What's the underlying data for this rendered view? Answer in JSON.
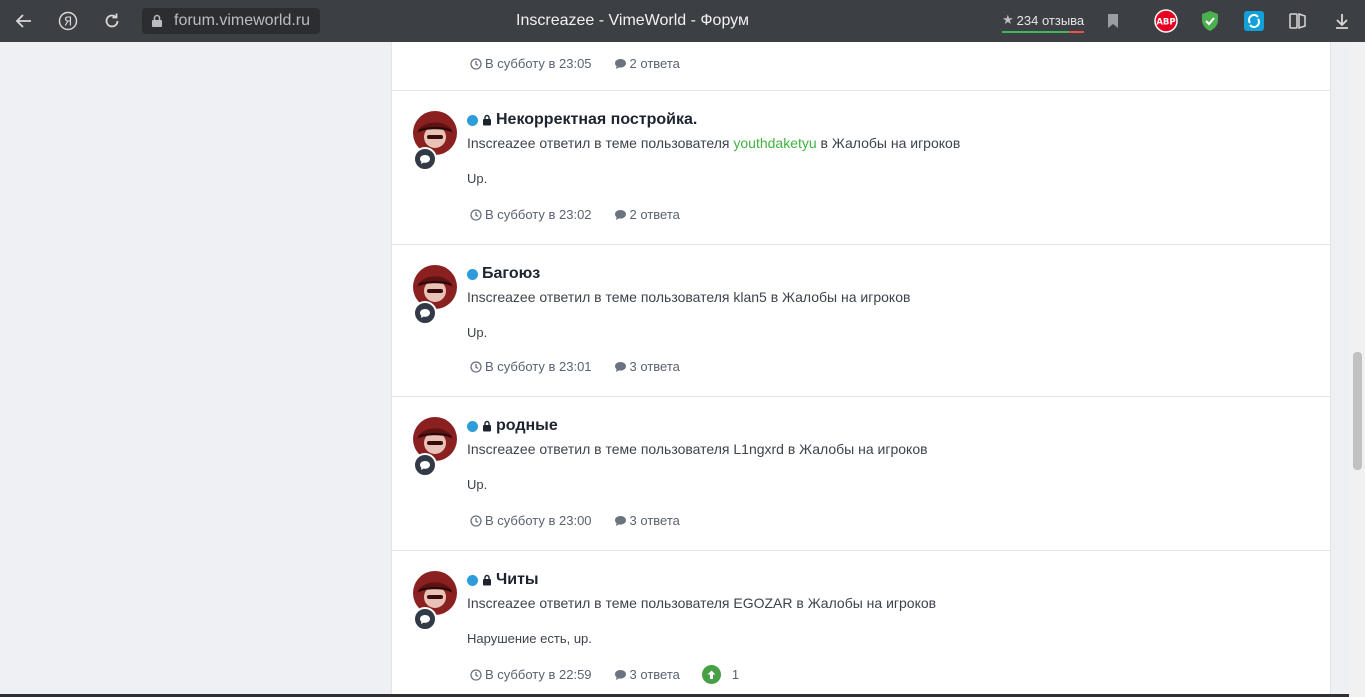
{
  "browser": {
    "url": "forum.vimeworld.ru",
    "tab_title": "Inscreazee - VimeWorld - Форум",
    "reviews_star": "★",
    "reviews_label": "234 отзыва",
    "back_icon": "back-arrow-icon",
    "yandex_icon": "yandex-icon",
    "reload_icon": "reload-icon",
    "abp_label": "ABP",
    "download_icon": "download-icon"
  },
  "colors": {
    "accent_blue": "#2e9cdb",
    "user_green": "#3fb33f",
    "upvote_green": "#47a047"
  },
  "top_entry": {
    "time": "В субботу в 23:05",
    "replies": "2 ответа"
  },
  "entries": [
    {
      "title": "Некорректная постройка.",
      "locked": true,
      "meta_prefix": "Inscreazee ответил в теме пользователя ",
      "user": "youthdaketyu",
      "meta_suffix": " в Жалобы на игроков",
      "snippet": "Up.",
      "time": "В субботу в 23:02",
      "replies": "2 ответа"
    },
    {
      "title": "Багоюз",
      "locked": false,
      "meta_prefix": "Inscreazee ответил в теме пользователя ",
      "user": "klan5",
      "meta_suffix": " в Жалобы на игроков",
      "snippet": "Up.",
      "time": "В субботу в 23:01",
      "replies": "3 ответа"
    },
    {
      "title": "родные",
      "locked": true,
      "meta_prefix": "Inscreazee ответил в теме пользователя ",
      "user": "L1ngxrd",
      "meta_suffix": " в Жалобы на игроков",
      "snippet": "Up.",
      "time": "В субботу в 23:00",
      "replies": "3 ответа"
    },
    {
      "title": "Читы",
      "locked": true,
      "meta_prefix": "Inscreazee ответил в теме пользователя ",
      "user": "EGOZAR",
      "meta_suffix": " в Жалобы на игроков",
      "snippet": "Нарушение есть, up.",
      "time": "В субботу в 22:59",
      "replies": "3 ответа",
      "reputation": "1"
    }
  ]
}
